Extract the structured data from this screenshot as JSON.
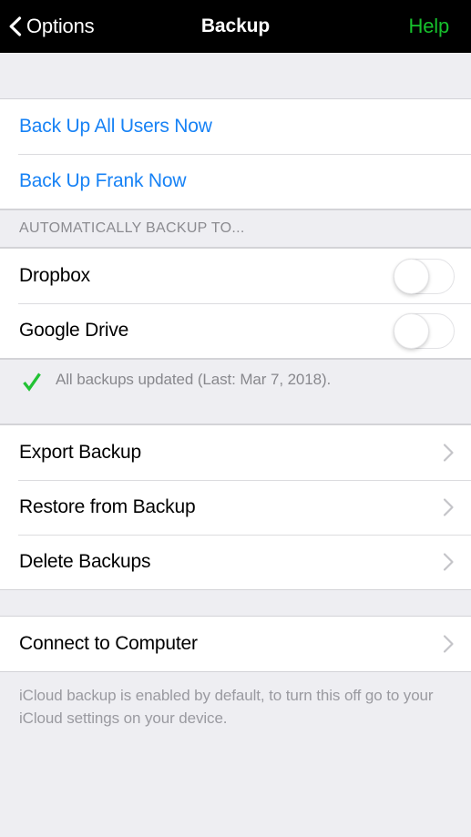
{
  "navbar": {
    "back_label": "Options",
    "back_icon": "chevron-left-icon",
    "title": "Backup",
    "help_label": "Help",
    "background_color": "#000000",
    "help_color": "#16c12c",
    "title_color": "#ffffff"
  },
  "colors": {
    "link_blue": "#1782f5",
    "checkmark_green": "#22c234",
    "page_background": "#eeeef2",
    "row_background": "#ffffff",
    "separator": "#dcdcdf",
    "chevron_gray": "#c4c4c8",
    "secondary_text": "#8b8b90"
  },
  "actions_group": {
    "rows": [
      {
        "label": "Back Up All Users Now",
        "style": "link"
      },
      {
        "label": "Back Up Frank Now",
        "style": "link"
      }
    ]
  },
  "auto_backup_section": {
    "header": "AUTOMATICALLY BACKUP TO...",
    "rows": [
      {
        "label": "Dropbox",
        "toggle_state": "off"
      },
      {
        "label": "Google Drive",
        "toggle_state": "off"
      }
    ]
  },
  "status": {
    "icon": "checkmark-icon",
    "text": "All backups updated (Last: Mar 7, 2018)."
  },
  "backup_actions_group": {
    "rows": [
      {
        "label": "Export Backup",
        "accessory": "chevron-right-icon"
      },
      {
        "label": "Restore from Backup",
        "accessory": "chevron-right-icon"
      },
      {
        "label": "Delete Backups",
        "accessory": "chevron-right-icon"
      }
    ]
  },
  "connect_group": {
    "rows": [
      {
        "label": "Connect to Computer",
        "accessory": "chevron-right-icon"
      }
    ]
  },
  "footer": {
    "text": "iCloud backup is enabled by default, to turn this off go to your iCloud settings on your device."
  }
}
